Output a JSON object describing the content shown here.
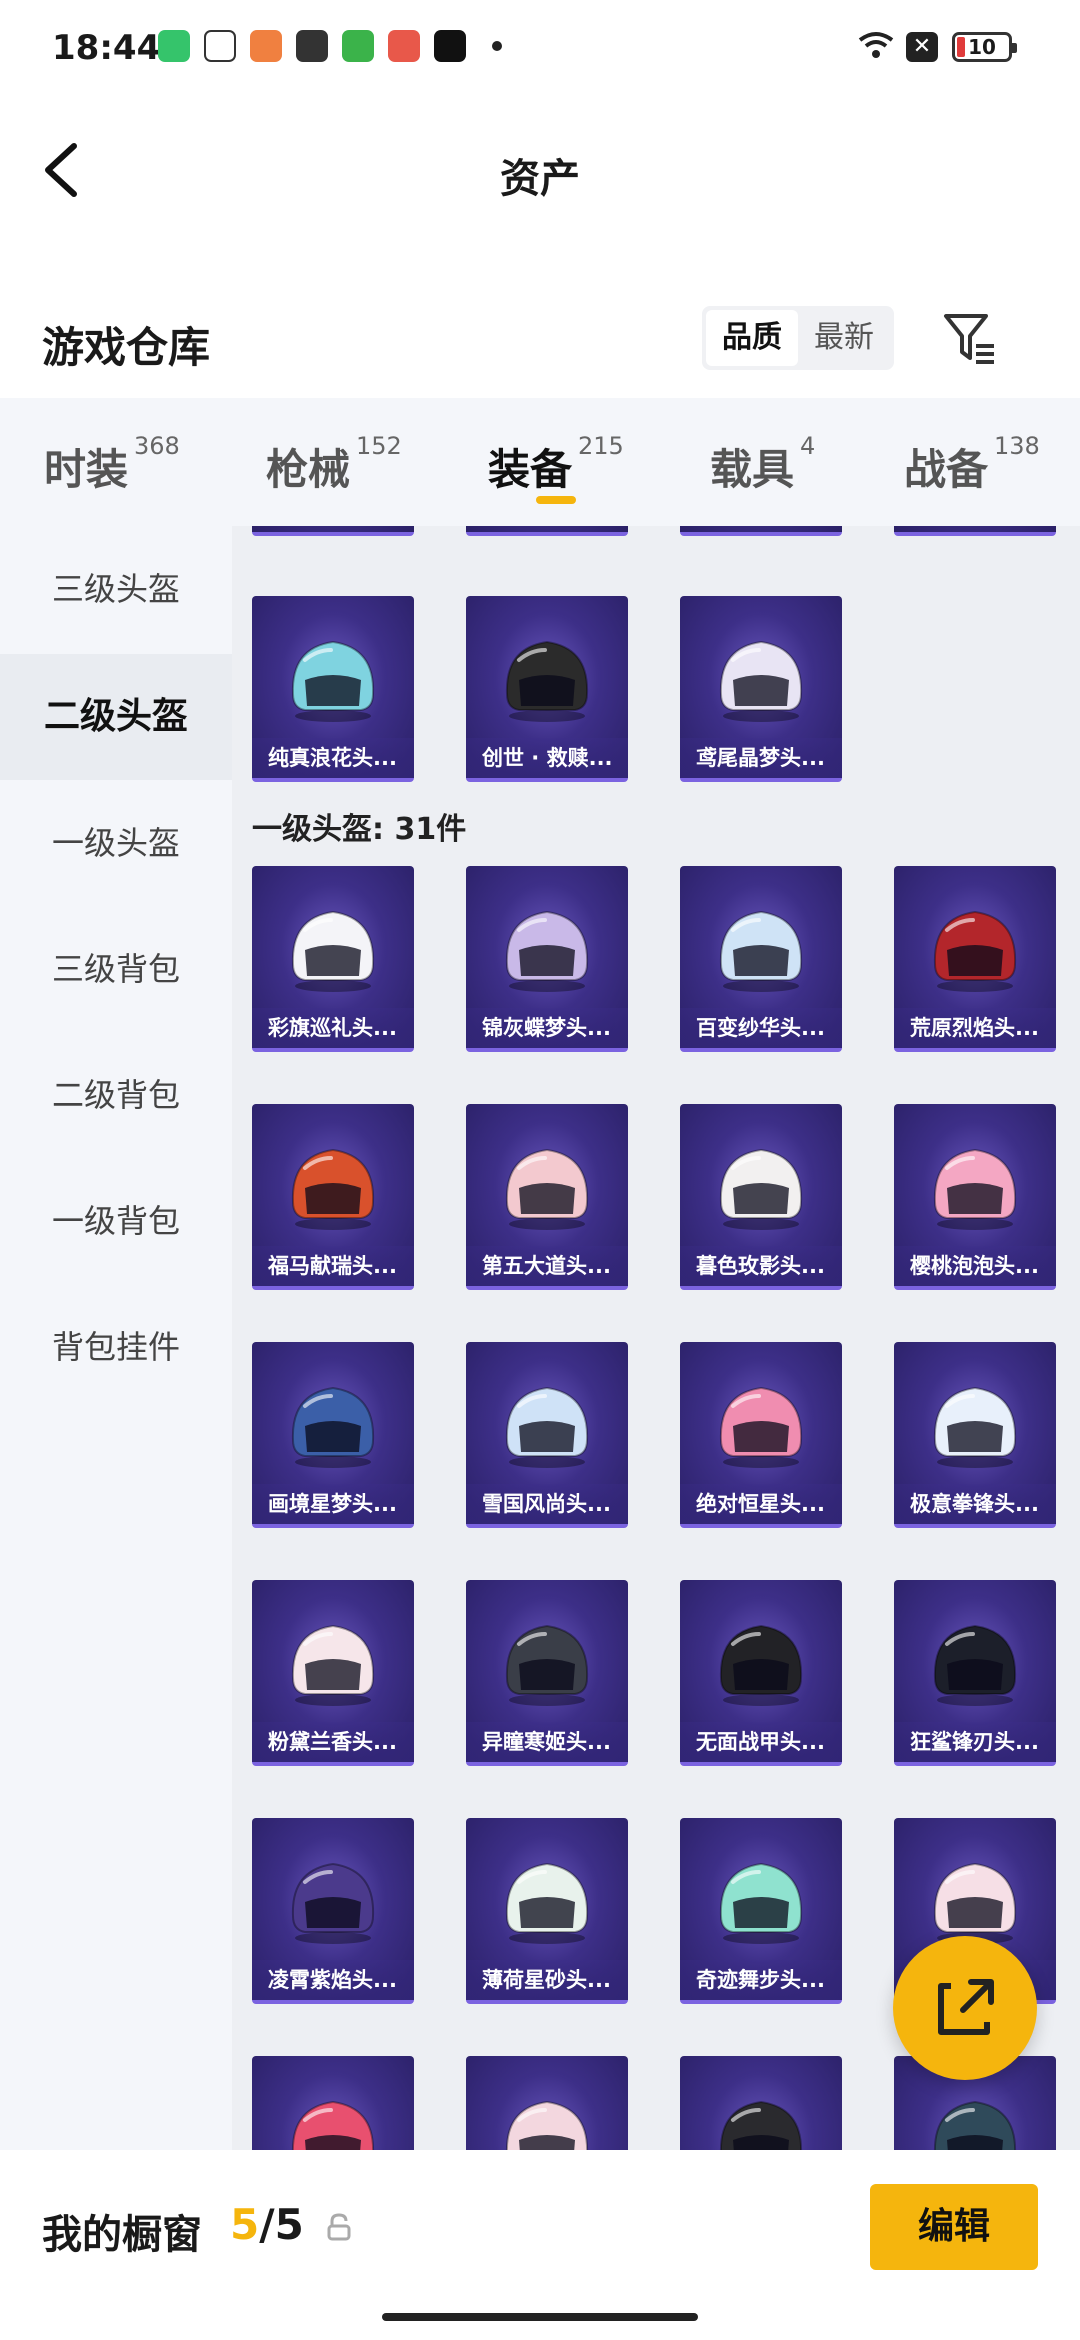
{
  "status_bar": {
    "time": "18:44",
    "battery": "10"
  },
  "header": {
    "title": "资产"
  },
  "section": {
    "title": "游戏仓库",
    "sort_options": [
      "品质",
      "最新"
    ],
    "active_sort": "品质"
  },
  "tabs": [
    {
      "label": "时装",
      "count": "368"
    },
    {
      "label": "枪械",
      "count": "152"
    },
    {
      "label": "装备",
      "count": "215",
      "active": true
    },
    {
      "label": "载具",
      "count": "4"
    },
    {
      "label": "战备",
      "count": "138"
    }
  ],
  "sidebar": [
    {
      "label": "三级头盔"
    },
    {
      "label": "二级头盔",
      "active": true
    },
    {
      "label": "一级头盔"
    },
    {
      "label": "三级背包"
    },
    {
      "label": "二级背包"
    },
    {
      "label": "一级背包"
    },
    {
      "label": "背包挂件"
    }
  ],
  "level2_items": [
    {
      "name": "纯真浪花头...",
      "color": "#7fd3e0"
    },
    {
      "name": "创世 · 救赎...",
      "color": "#2b2b2b"
    },
    {
      "name": "鸢尾晶梦头...",
      "color": "#e8e4f4"
    }
  ],
  "group_label": "一级头盔: 31件",
  "level1_items": [
    {
      "name": "彩旗巡礼头...",
      "color": "#f4f4f8"
    },
    {
      "name": "锦灰蝶梦头...",
      "color": "#c9b9e8"
    },
    {
      "name": "百变纱华头...",
      "color": "#cfe3f6"
    },
    {
      "name": "荒原烈焰头...",
      "color": "#b3262b"
    },
    {
      "name": "福马献瑞头...",
      "color": "#d9512c"
    },
    {
      "name": "第五大道头...",
      "color": "#f3c9cf"
    },
    {
      "name": "暮色玫影头...",
      "color": "#f2f0f0"
    },
    {
      "name": "樱桃泡泡头...",
      "color": "#f4a7c3"
    },
    {
      "name": "画境星梦头...",
      "color": "#3b5fa8"
    },
    {
      "name": "雪国风尚头...",
      "color": "#cfe2f7"
    },
    {
      "name": "绝对恒星头...",
      "color": "#f08db0"
    },
    {
      "name": "极意拳锋头...",
      "color": "#e8f0fb"
    },
    {
      "name": "粉黛兰香头...",
      "color": "#f6e6ea"
    },
    {
      "name": "异瞳寒姬头...",
      "color": "#3a3e48"
    },
    {
      "name": "无面战甲头...",
      "color": "#222226"
    },
    {
      "name": "狂鲨锋刃头...",
      "color": "#1c1f2a"
    },
    {
      "name": "凌霄紫焰头...",
      "color": "#4b3a8c"
    },
    {
      "name": "薄荷星砂头...",
      "color": "#e8f2ec"
    },
    {
      "name": "奇迹舞步头...",
      "color": "#8fe2cf"
    },
    {
      "name": "",
      "color": "#f6dfe6"
    }
  ],
  "bottom": {
    "label": "我的橱窗",
    "current": "5",
    "total": "/5",
    "edit": "编辑"
  },
  "colors": {
    "accent": "#f5b50d",
    "card_bg": "#3d2f88"
  }
}
